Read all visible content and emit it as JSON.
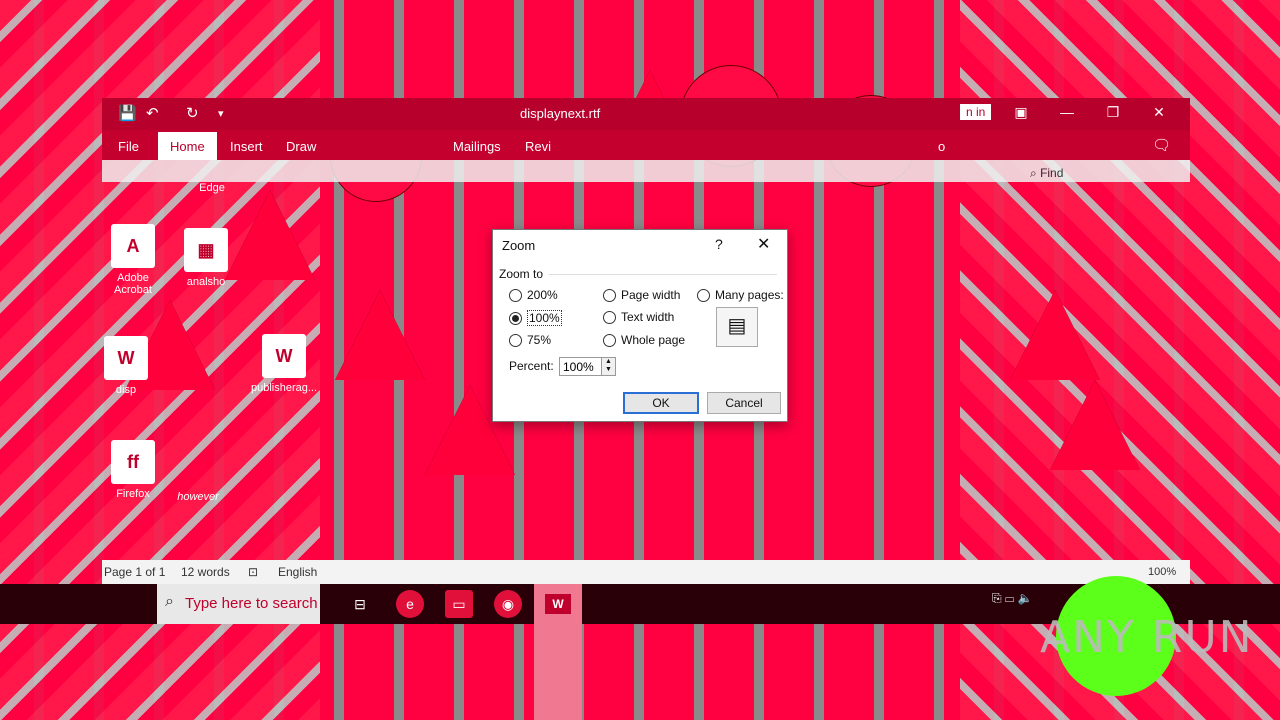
{
  "word": {
    "document_title": "displaynext.rtf",
    "sign_in": "n in",
    "tabs": [
      "File",
      "Home",
      "Insert",
      "Draw",
      "Mailings",
      "Revi",
      "o"
    ],
    "find_label": "Find"
  },
  "desktop": {
    "icons": [
      {
        "label": "Adobe Acrobat",
        "glyph": "A"
      },
      {
        "label": "analsho",
        "glyph": "▦"
      },
      {
        "label": "disp",
        "glyph": "W"
      },
      {
        "label": "publisherag...",
        "glyph": "W"
      },
      {
        "label": "Firefox",
        "glyph": "ff"
      },
      {
        "label": "however",
        "glyph": ""
      }
    ],
    "edge_label": "Edge"
  },
  "dialog": {
    "title": "Zoom",
    "help": "?",
    "close": "✕",
    "zoom_to": "Zoom to",
    "options": {
      "p200": "200%",
      "p100": "100%",
      "p75": "75%",
      "page_width": "Page width",
      "text_width": "Text width",
      "whole_page": "Whole page",
      "many_pages": "Many pages:"
    },
    "selected": "100%",
    "percent_label": "Percent:",
    "percent_value": "100%",
    "ok": "OK",
    "cancel": "Cancel"
  },
  "status": {
    "page": "Page 1 of 1",
    "words": "12 words",
    "language": "English",
    "zoom": "100%"
  },
  "taskbar": {
    "search_placeholder": "Type here to search"
  },
  "watermark": "ANY RUN"
}
